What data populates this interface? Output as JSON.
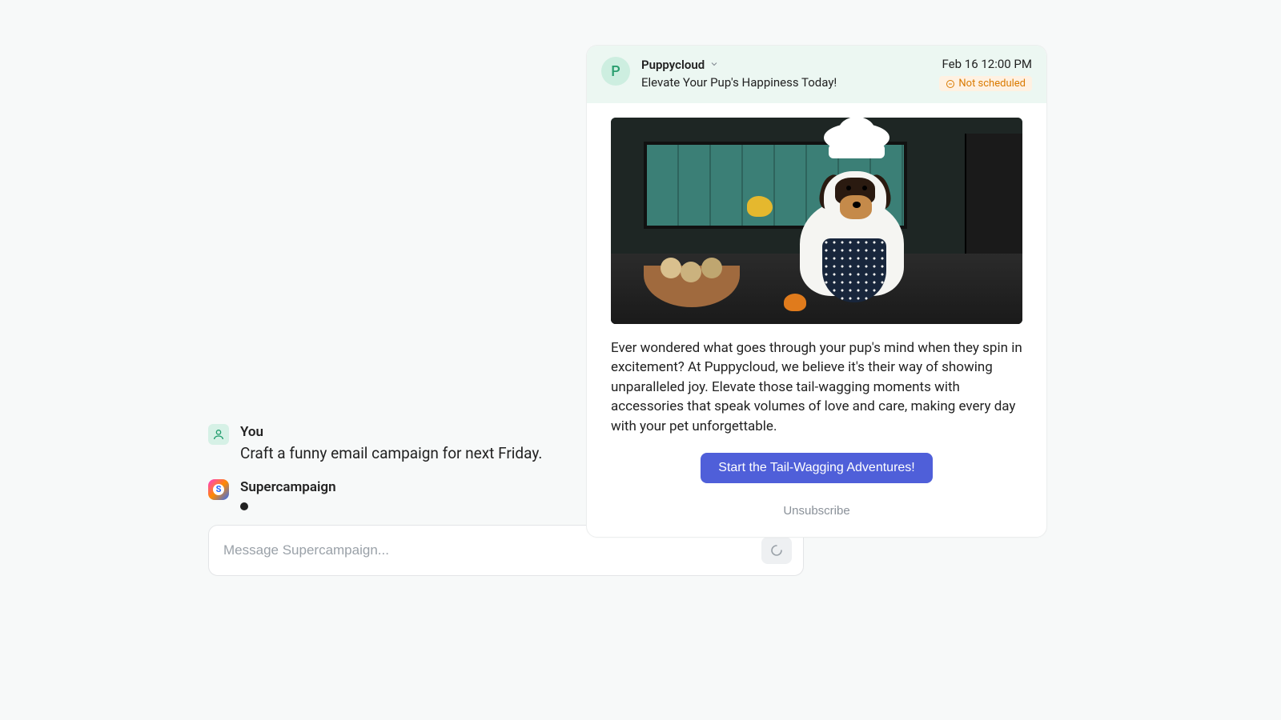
{
  "chat": {
    "you_label": "You",
    "you_message": "Craft a funny email campaign for next Friday.",
    "assistant_label": "Supercampaign"
  },
  "composer": {
    "placeholder": "Message Supercampaign..."
  },
  "preview": {
    "brand_initial": "P",
    "brand_name": "Puppycloud",
    "subject": "Elevate Your Pup's Happiness Today!",
    "timestamp": "Feb 16 12:00 PM",
    "status": "Not scheduled",
    "hero_alt": "Dog wearing a chef hat and polka-dot apron sitting at a kitchen counter with vegetables",
    "body_copy": "Ever wondered what goes through your pup's mind when they spin in excitement? At Puppycloud, we believe it's their way of showing unparalleled joy. Elevate those tail-wagging moments with accessories that speak volumes of love and care, making every day with your pet unforgettable.",
    "cta_label": "Start the Tail-Wagging Adventures!",
    "unsubscribe_label": "Unsubscribe"
  }
}
